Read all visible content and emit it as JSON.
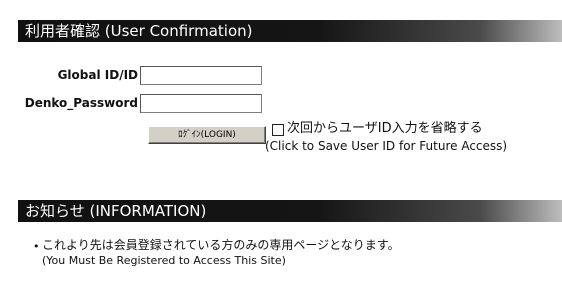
{
  "login_section": {
    "title": "利用者確認 (User Confirmation)",
    "id_label": "Global ID/ID",
    "id_value": "",
    "password_label": "Denko_Password",
    "password_value": "",
    "login_button": "ﾛｸﾞｲﾝ(LOGIN)",
    "remember": {
      "checked": false,
      "label_jp": "次回からユーザID入力を省略する",
      "label_en": "(Click to Save User ID for Future Access)"
    }
  },
  "info_section": {
    "title": "お知らせ (INFORMATION)",
    "items": [
      {
        "bullet": "•",
        "text_jp": "これより先は会員登録されている方のみの専用ページとなります。",
        "text_en": "(You Must Be Registered to Access This Site)"
      }
    ]
  },
  "colors": {
    "bar_dark": "#111111",
    "bar_fade": "#bdbdbd",
    "bar_text": "#ffffff",
    "button_face": "#d4d0c8"
  }
}
